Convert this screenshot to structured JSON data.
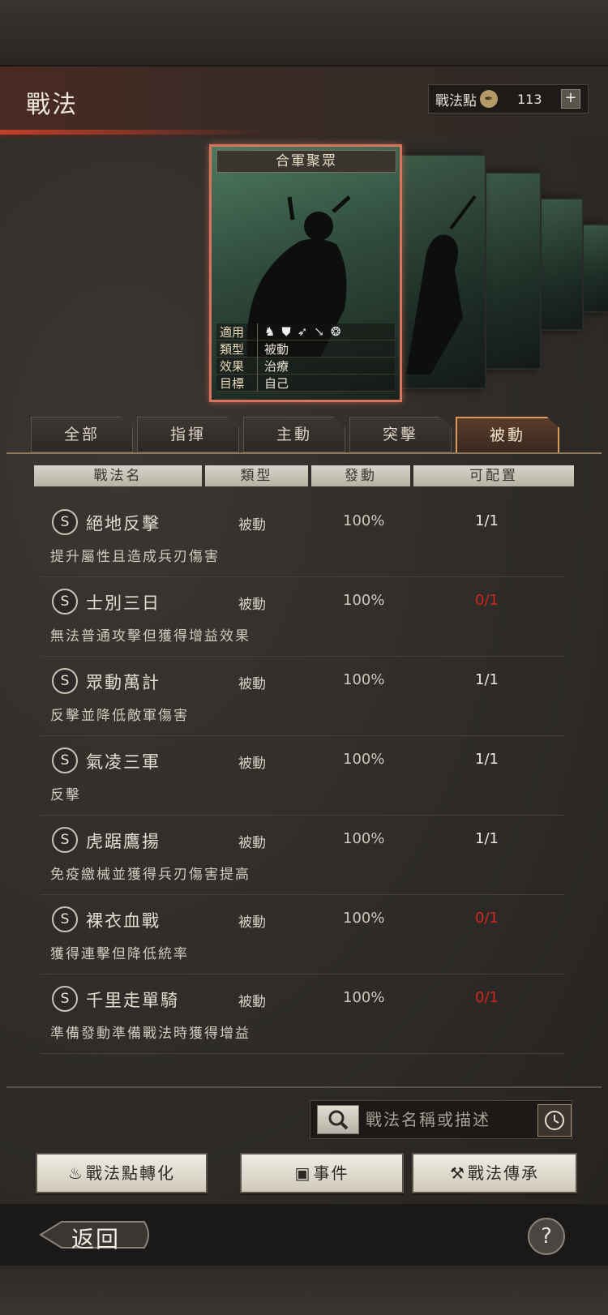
{
  "header": {
    "title": "戰法",
    "points_label": "戰法點",
    "points_value": "113",
    "plus_symbol": "+"
  },
  "card": {
    "title": "合軍聚眾",
    "applicable_key": "適用",
    "type_key": "類型",
    "type_value": "被動",
    "effect_key": "效果",
    "effect_value": "治療",
    "target_key": "目標",
    "target_value": "自己",
    "unit_icons": [
      "cavalry-icon",
      "shield-icon",
      "bow-icon",
      "spear-icon",
      "wheel-icon"
    ]
  },
  "tabs": [
    {
      "label": "全部",
      "active": false
    },
    {
      "label": "指揮",
      "active": false
    },
    {
      "label": "主動",
      "active": false
    },
    {
      "label": "突擊",
      "active": false
    },
    {
      "label": "被動",
      "active": true
    }
  ],
  "columns": {
    "name": "戰法名",
    "type": "類型",
    "rate": "發動",
    "slots": "可配置"
  },
  "rows": [
    {
      "grade": "S",
      "name": "絕地反擊",
      "type": "被動",
      "rate": "100%",
      "slots": "1/1",
      "desc": "提升屬性且造成兵刃傷害",
      "available": true
    },
    {
      "grade": "S",
      "name": "士別三日",
      "type": "被動",
      "rate": "100%",
      "slots": "0/1",
      "desc": "無法普通攻擊但獲得增益效果",
      "available": false
    },
    {
      "grade": "S",
      "name": "眾動萬計",
      "type": "被動",
      "rate": "100%",
      "slots": "1/1",
      "desc": "反擊並降低敵軍傷害",
      "available": true
    },
    {
      "grade": "S",
      "name": "氣凌三軍",
      "type": "被動",
      "rate": "100%",
      "slots": "1/1",
      "desc": "反擊",
      "available": true
    },
    {
      "grade": "S",
      "name": "虎踞鷹揚",
      "type": "被動",
      "rate": "100%",
      "slots": "1/1",
      "desc": "免疫繳械並獲得兵刃傷害提高",
      "available": true
    },
    {
      "grade": "S",
      "name": "裸衣血戰",
      "type": "被動",
      "rate": "100%",
      "slots": "0/1",
      "desc": "獲得連擊但降低統率",
      "available": false
    },
    {
      "grade": "S",
      "name": "千里走單騎",
      "type": "被動",
      "rate": "100%",
      "slots": "0/1",
      "desc": "準備發動準備戰法時獲得增益",
      "available": false
    }
  ],
  "search": {
    "placeholder": "戰法名稱或描述"
  },
  "buttons": {
    "convert": "戰法點轉化",
    "event": "事件",
    "inherit": "戰法傳承"
  },
  "footer": {
    "back": "返回",
    "help": "?"
  },
  "colors": {
    "accent_red": "#d2261e",
    "active_tab_border": "#e0985a",
    "card_border": "#d8745e"
  }
}
